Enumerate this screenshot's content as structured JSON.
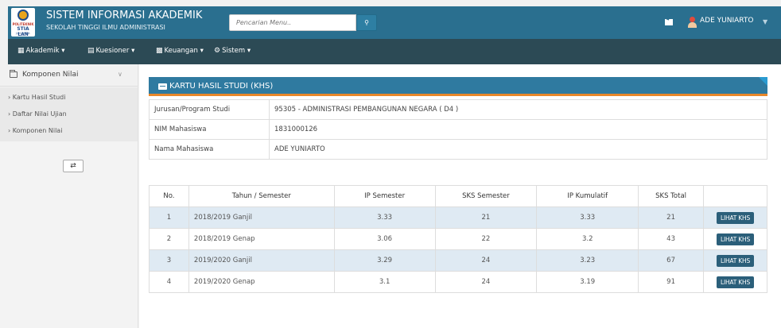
{
  "header": {
    "logo": {
      "line1": "POLITEKNIK",
      "line2": "STIA LAN",
      "line3": "JAKARTA"
    },
    "title": "SISTEM INFORMASI AKADEMIK",
    "subtitle": "SEKOLAH TINGGI ILMU ADMINISTRASI",
    "search": {
      "placeholder": "Pencarian Menu.."
    },
    "user": {
      "name": "ADE YUNIARTO"
    },
    "colors": {
      "header": "#2a6f8f",
      "nav": "#2c4a55",
      "panel": "#2f7aa0",
      "accent": "#e8872a"
    }
  },
  "nav": {
    "items": [
      {
        "label": "Akademik",
        "icon": "institution-icon"
      },
      {
        "label": "Kuesioner",
        "icon": "document-icon"
      },
      {
        "label": "Keuangan",
        "icon": "money-icon"
      },
      {
        "label": "Sistem",
        "icon": "gear-icon"
      }
    ]
  },
  "sidebar": {
    "title": "Komponen Nilai",
    "items": [
      {
        "label": "Kartu Hasil Studi"
      },
      {
        "label": "Daftar Nilai Ujian"
      },
      {
        "label": "Komponen Nilai"
      }
    ]
  },
  "panel": {
    "title": "KARTU HASIL STUDI (KHS)",
    "info": [
      {
        "label": "Jurusan/Program Studi",
        "value": "95305 - ADMINISTRASI PEMBANGUNAN NEGARA ( D4 )"
      },
      {
        "label": "NIM Mahasiswa",
        "value": "1831000126"
      },
      {
        "label": "Nama Mahasiswa",
        "value": "ADE YUNIARTO"
      }
    ]
  },
  "table": {
    "headers": [
      "No.",
      "Tahun / Semester",
      "IP Semester",
      "SKS Semester",
      "IP Kumulatif",
      "SKS Total",
      ""
    ],
    "button_label": "LIHAT KHS",
    "rows": [
      {
        "no": "1",
        "semester": "2018/2019 Ganjil",
        "ip_semester": "3.33",
        "sks_semester": "21",
        "ip_kumulatif": "3.33",
        "sks_total": "21"
      },
      {
        "no": "2",
        "semester": "2018/2019 Genap",
        "ip_semester": "3.06",
        "sks_semester": "22",
        "ip_kumulatif": "3.2",
        "sks_total": "43"
      },
      {
        "no": "3",
        "semester": "2019/2020 Ganjil",
        "ip_semester": "3.29",
        "sks_semester": "24",
        "ip_kumulatif": "3.23",
        "sks_total": "67"
      },
      {
        "no": "4",
        "semester": "2019/2020 Genap",
        "ip_semester": "3.1",
        "sks_semester": "24",
        "ip_kumulatif": "3.19",
        "sks_total": "91"
      }
    ]
  }
}
